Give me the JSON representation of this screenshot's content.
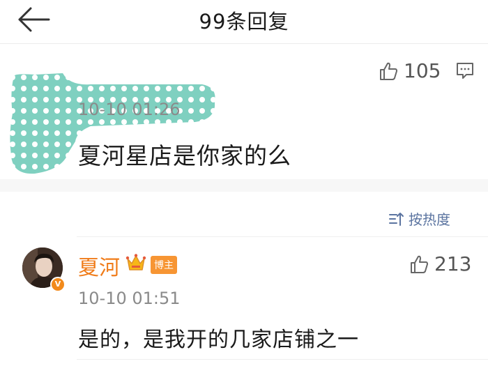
{
  "header": {
    "title": "99条回复",
    "back_icon": "arrow-left-icon"
  },
  "main_comment": {
    "likes": "105",
    "time": "10-10 01:26",
    "text": "夏河星店是你家的么",
    "avatar_state": "obscured-by-dot-pattern"
  },
  "sort": {
    "label": "按热度"
  },
  "reply": {
    "name": "夏河",
    "badge": "博主",
    "verified_label": "V",
    "likes": "213",
    "time": "10-10 01:51",
    "text": "是的，是我开的几家店铺之一"
  },
  "colors": {
    "name_orange": "#f07c1a",
    "link_blue": "#5b74a0",
    "mask_teal": "#7fd0c0",
    "tag_orange": "#f79533",
    "background": "#f7f7f7"
  }
}
